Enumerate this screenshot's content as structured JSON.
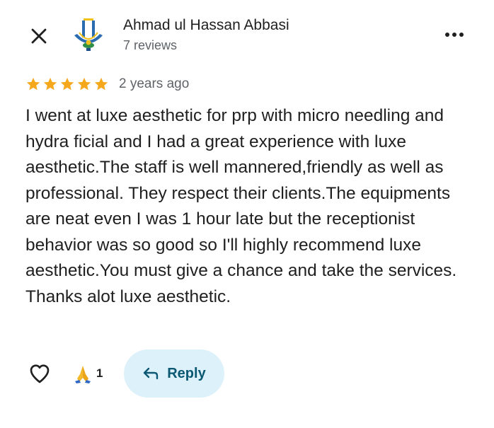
{
  "header": {
    "close_icon": "close-icon",
    "author_name": "Ahmad ul Hassan Abbasi",
    "review_count": "7 reviews",
    "more_icon": "more-horizontal-icon"
  },
  "review": {
    "rating": 5,
    "rating_max": 5,
    "star_color": "#f6a81c",
    "date": "2 years ago",
    "text": "I went at luxe aesthetic for prp with micro needling and hydra ficial and I had a great experience with luxe aesthetic.The staff is well mannered,friendly as well as professional. They respect their clients.The equipments are neat even I was 1 hour late but the receptionist behavior was so good so I'll highly recommend luxe aesthetic.You must give a chance and take the services.\nThanks alot luxe aesthetic."
  },
  "actions": {
    "like_icon": "heart-outline-icon",
    "reaction_icon": "praying-hands-icon",
    "reaction_count": "1",
    "reply_icon": "reply-arrow-icon",
    "reply_label": "Reply",
    "reply_bg": "#ddf1fb",
    "reply_text_color": "#0b5873"
  }
}
